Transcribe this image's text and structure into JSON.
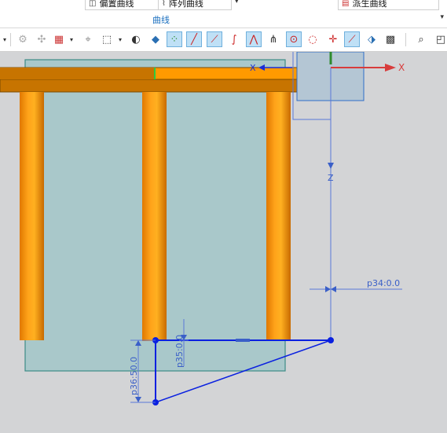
{
  "ribbon": {
    "btn_offset_curve": "偏置曲线",
    "btn_pattern_curve": "阵列曲线",
    "btn_derived_curve": "派生曲线",
    "group_label": "曲线",
    "collapse_arrow": "▾",
    "dropdown_arrow": "▾"
  },
  "toolbar": {
    "dropdown_arrow": "▾",
    "selected_tools": [
      "snap-control-point",
      "snap-endpoint",
      "snap-midpoint",
      "snap-intersection",
      "snap-arc-center",
      "snap-point-on-curve"
    ]
  },
  "viewport": {
    "axis_x_label": "X",
    "axis_x_label_2": "X",
    "axis_z_label": "Z",
    "dim_p34": "p34:0.0",
    "dim_p35": "p35:0.0",
    "dim_p36": "p36:50.0",
    "colors": {
      "background": "#d3d4d6",
      "panel": "#a9c8ca",
      "wood": "#ff9a00",
      "wood_dark": "#c77400",
      "sketch_blue": "#0a20e0",
      "dim_blue": "#3a5fc8",
      "x_axis_red": "#d83c3c"
    }
  }
}
